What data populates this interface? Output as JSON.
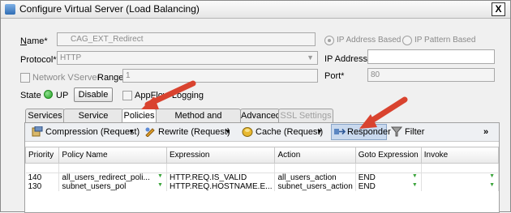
{
  "window": {
    "title": "Configure Virtual Server (Load Balancing)",
    "close": "X"
  },
  "form": {
    "name_label": "Name*",
    "name_value": "CAG_EXT_Redirect",
    "protocol_label": "Protocol*",
    "protocol_value": "HTTP",
    "ip_based_label": "IP Address Based",
    "ip_pattern_label": "IP Pattern Based",
    "ip_address_label": "IP Address*",
    "ip_address_value": "",
    "network_vserver_label": "Network VServer",
    "range_label": "Range",
    "range_value": "1",
    "port_label": "Port*",
    "port_value": "80",
    "appflow_label": "AppFlow Logging",
    "state_label": "State",
    "state_value": "UP",
    "disable_button": "Disable"
  },
  "tabs": [
    {
      "label": "Services"
    },
    {
      "label": "Service Groups"
    },
    {
      "label": "Policies"
    },
    {
      "label": "Method and Persistence"
    },
    {
      "label": "Advanced"
    },
    {
      "label": "SSL Settings"
    }
  ],
  "toolbar": {
    "compression": "Compression (Request)",
    "rewrite": "Rewrite (Request)",
    "cache": "Cache (Request)",
    "responder": "Responder",
    "filter": "Filter",
    "more": "»"
  },
  "table": {
    "columns": [
      "Priority",
      "Policy Name",
      "Expression",
      "Action",
      "Goto Expression",
      "Invoke"
    ],
    "rows": [
      {
        "priority": "140",
        "policy": "all_users_redirect_poli...",
        "expression": "HTTP.REQ.IS_VALID",
        "action": "all_users_action",
        "goto": "END",
        "invoke": ""
      },
      {
        "priority": "130",
        "policy": "subnet_users_pol",
        "expression": "HTTP.REQ.HOSTNAME.E...",
        "action": "subnet_users_action",
        "goto": "END",
        "invoke": ""
      }
    ]
  },
  "colors": {
    "annotation_arrow": "#d9432f",
    "status_up": "#23a023",
    "responder_active": "#c9d9ee"
  }
}
